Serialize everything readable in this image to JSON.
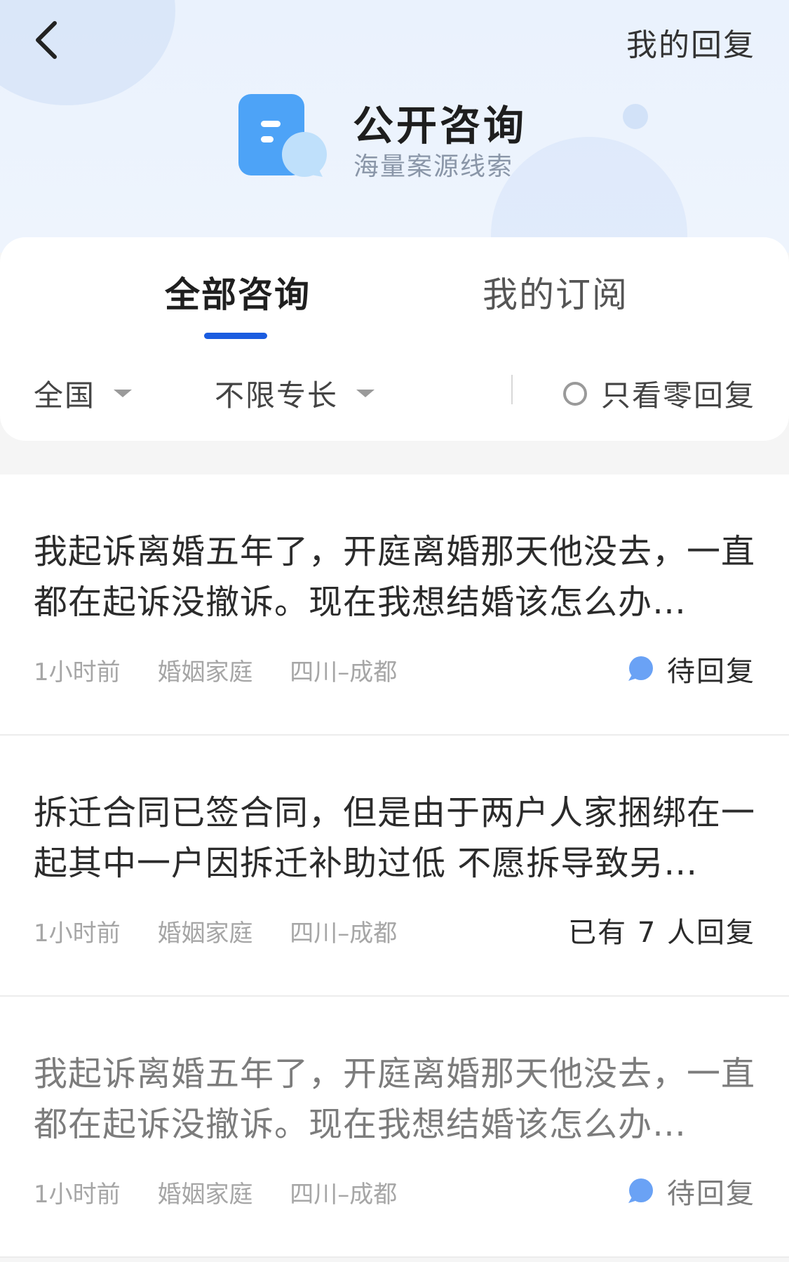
{
  "header": {
    "my_reply": "我的回复",
    "title": "公开咨询",
    "subtitle": "海量案源线索",
    "icon": "chat-document-icon"
  },
  "tabs": [
    {
      "label": "全部咨询",
      "active": true
    },
    {
      "label": "我的订阅",
      "active": false
    }
  ],
  "filters": {
    "region": "全国",
    "specialty": "不限专长",
    "zero_reply": "只看零回复"
  },
  "colors": {
    "accent": "#1a5ce0",
    "bubble": "#6aa2f5"
  },
  "items": [
    {
      "title": "我起诉离婚五年了，开庭离婚那天他没去，一直都在起诉没撤诉。现在我想结婚该怎么办…",
      "time": "1小时前",
      "category": "婚姻家庭",
      "location": "四川–成都",
      "status": "待回复"
    },
    {
      "title": "拆迁合同已签合同，但是由于两户人家捆绑在一起其中一户因拆迁补助过低 不愿拆导致另…",
      "time": "1小时前",
      "category": "婚姻家庭",
      "location": "四川–成都",
      "status": "已有 7 人回复"
    },
    {
      "title": "我起诉离婚五年了，开庭离婚那天他没去，一直都在起诉没撤诉。现在我想结婚该怎么办…",
      "time": "1小时前",
      "category": "婚姻家庭",
      "location": "四川–成都",
      "status": "待回复"
    }
  ]
}
